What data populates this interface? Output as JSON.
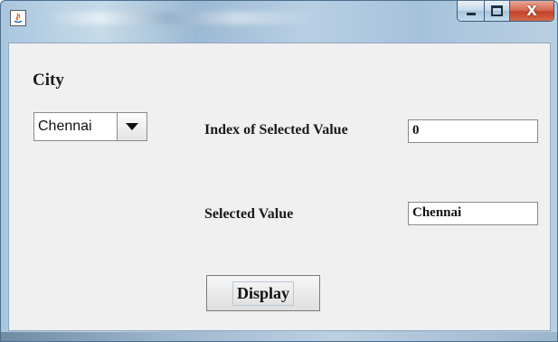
{
  "window": {
    "title": "",
    "icon": "java-cup-icon",
    "buttons": {
      "minimize_icon": "minimize-icon",
      "maximize_icon": "maximize-icon",
      "close_glyph": "X"
    }
  },
  "form": {
    "city_label": "City",
    "city_combo": {
      "selected": "Chennai",
      "arrow_icon": "chevron-down-icon"
    },
    "index_label": "Index of Selected Value",
    "index_value": "0",
    "selected_label": "Selected Value",
    "selected_value": "Chennai",
    "display_button": "Display"
  },
  "colors": {
    "client_background": "#f0f0f0",
    "close_button": "#c2432a"
  }
}
